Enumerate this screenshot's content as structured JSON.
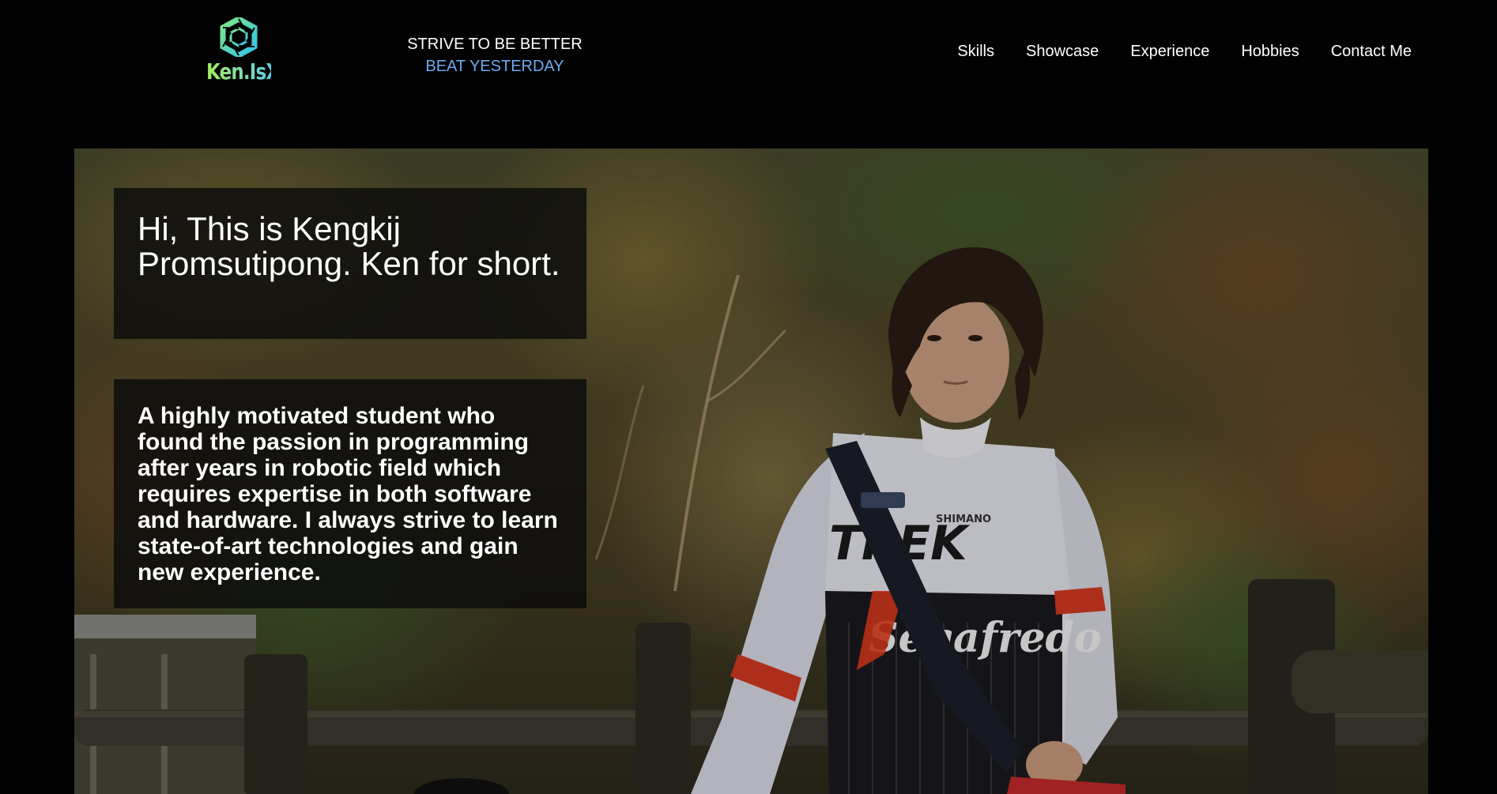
{
  "brand": {
    "logo_text": "Ken.IsX",
    "logo_icon": "aperture-icon",
    "colors": {
      "logo_text": "#8ee86a",
      "logo_icon_primary": "#33c3e8",
      "logo_icon_secondary": "#7fe88a"
    }
  },
  "tagline": {
    "line1": "STRIVE TO BE BETTER",
    "line2": "BEAT YESTERDAY"
  },
  "nav": {
    "items": [
      {
        "label": "Skills"
      },
      {
        "label": "Showcase"
      },
      {
        "label": "Experience"
      },
      {
        "label": "Hobbies"
      },
      {
        "label": "Contact Me"
      }
    ]
  },
  "hero": {
    "image_icon": "cyclist-photo",
    "greeting": "Hi, This is Kengkij Promsutipong. Ken for short.",
    "bio": "A highly motivated student who found the passion in programming after years in robotic field which requires expertise in both software and hardware. I always strive to learn state-of-art technologies and gain new experience.",
    "jersey_brand": "TREK",
    "jersey_sponsor": "Segafredo",
    "jersey_sub": "SHIMANO"
  },
  "colors": {
    "background": "#020202",
    "accent": "#6fa9ee",
    "card_bg": "rgba(12,12,12,0.84)"
  }
}
